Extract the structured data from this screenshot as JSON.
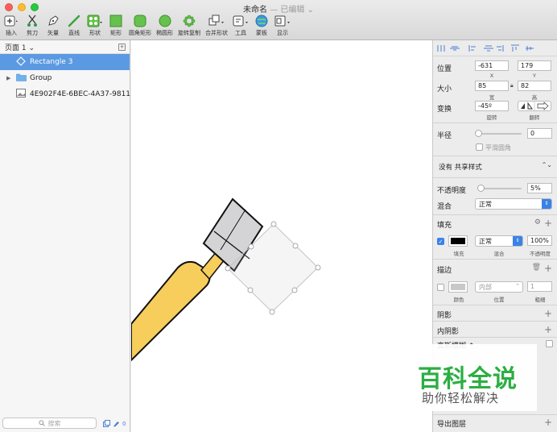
{
  "window": {
    "title": "未命名",
    "subtitle": "— 已编辑 ⌄"
  },
  "toolbar": [
    {
      "name": "insert",
      "label": "插入"
    },
    {
      "name": "scissors",
      "label": "剪刀"
    },
    {
      "name": "vector",
      "label": "矢量"
    },
    {
      "name": "line",
      "label": "直线"
    },
    {
      "name": "shape",
      "label": "形状"
    },
    {
      "name": "rectangle",
      "label": "矩形"
    },
    {
      "name": "rounded-rect",
      "label": "圆角矩形"
    },
    {
      "name": "oval",
      "label": "椭圆形"
    },
    {
      "name": "rotate-copy",
      "label": "旋转复制"
    },
    {
      "name": "combine",
      "label": "合并形状"
    },
    {
      "name": "tools",
      "label": "工具"
    },
    {
      "name": "artboard",
      "label": "蒙板"
    },
    {
      "name": "view",
      "label": "显示"
    }
  ],
  "layers": {
    "page_label": "页面 1 ⌄",
    "items": [
      {
        "label": "Rectangle 3"
      },
      {
        "label": "Group"
      },
      {
        "label": "4E902F4E-6BEC-4A37-9811..."
      }
    ],
    "search_placeholder": "搜索",
    "bottom_count": "0"
  },
  "inspector": {
    "position": {
      "label": "位置",
      "x": "-631",
      "y": "179",
      "x_caption": "X",
      "y_caption": "Y"
    },
    "size": {
      "label": "大小",
      "w": "85",
      "h": "82",
      "w_caption": "宽",
      "h_caption": "高"
    },
    "transform": {
      "label": "变换",
      "rotate": "-45º",
      "rotate_caption": "旋转",
      "flip_caption": "翻转"
    },
    "radius": {
      "label": "半径",
      "value": "0",
      "smooth_label": "平滑圆角"
    },
    "shared_style": "没有 共享样式",
    "opacity": {
      "label": "不透明度",
      "value": "5%",
      "fraction": 0.05
    },
    "blend": {
      "label": "混合",
      "value": "正常"
    },
    "fill": {
      "header": "填充",
      "color": "#000000",
      "blend": "正常",
      "opacity": "100%",
      "caption_fill": "填充",
      "caption_blend": "混合",
      "caption_opacity": "不透明度"
    },
    "border": {
      "header": "描边",
      "color": "#c8c8c8",
      "position": "内部",
      "width": "1",
      "caption_color": "颜色",
      "caption_position": "位置",
      "caption_width": "粗细"
    },
    "shadow": {
      "header": "阴影"
    },
    "inner_shadow": {
      "header": "内阴影"
    },
    "blur": {
      "header": "高斯模糊 ⌃"
    },
    "export": {
      "header": "导出图层"
    }
  },
  "watermark": {
    "main": "百科全说",
    "sub": "助你轻松解决"
  },
  "colors": {
    "selection": "#5b9ae2",
    "accent": "#3b82e6",
    "hammer_handle": "#f7cd5b",
    "hammer_head": "#d4d4d6",
    "watermark_green": "#2cae43"
  }
}
